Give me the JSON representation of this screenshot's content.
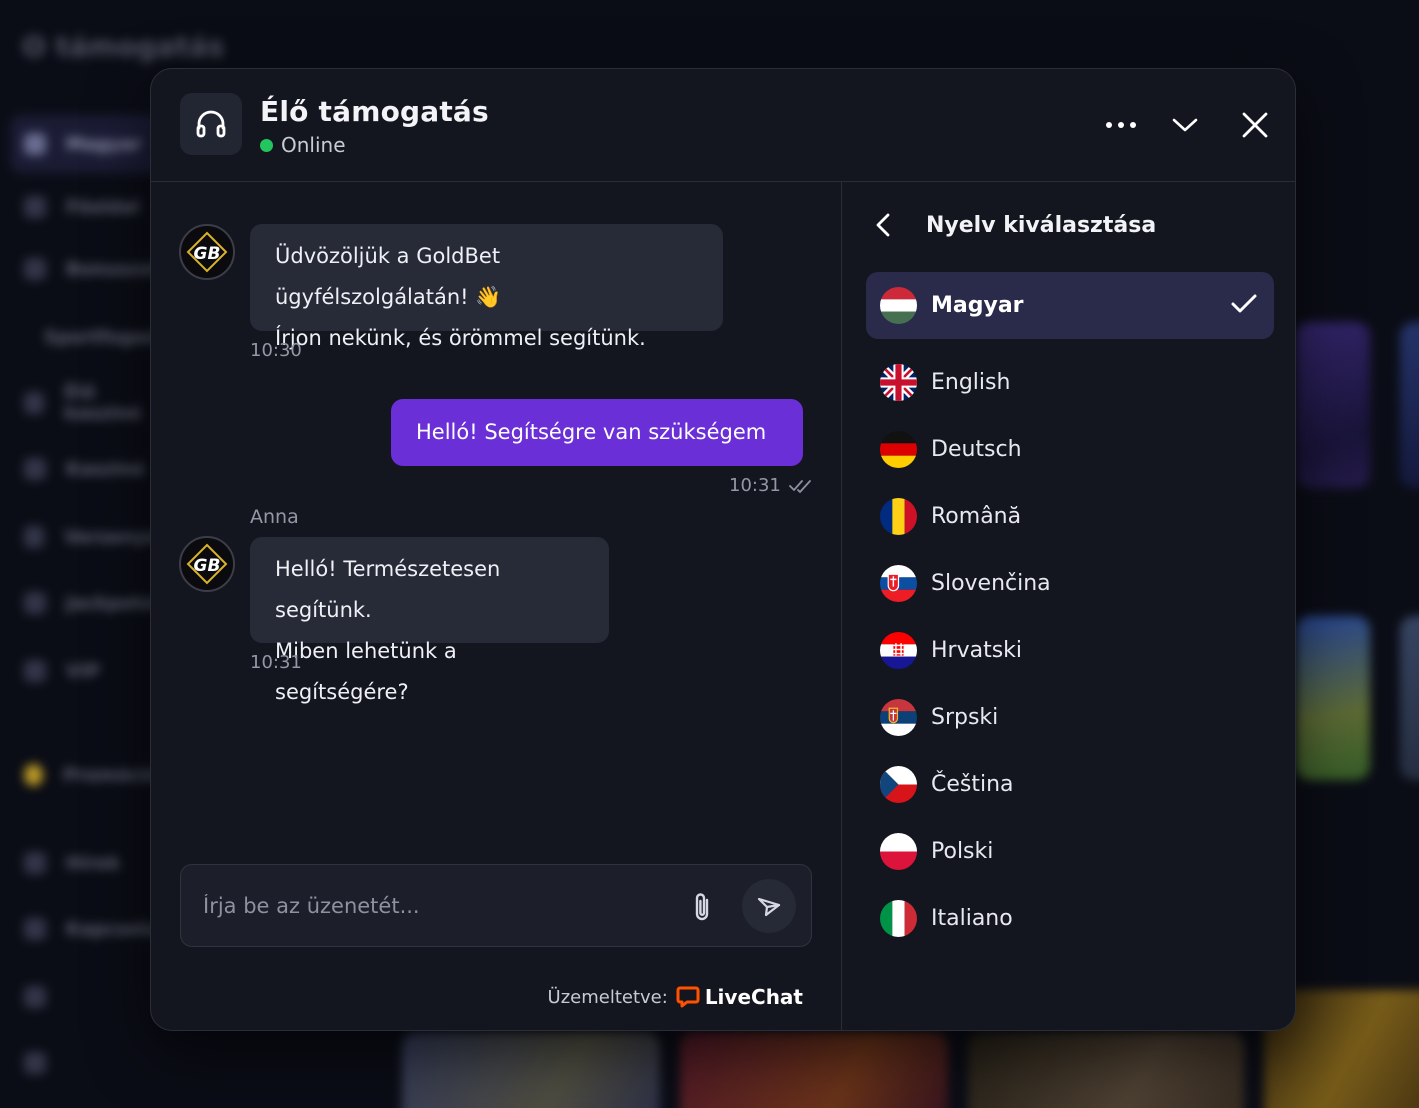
{
  "background": {
    "app_name": "támogatás",
    "sidebar_items": [
      "Magyar",
      "Főoldal",
      "Bonuszok",
      "Sportfogadás",
      "Élő kaszinó",
      "Kaszinó",
      "Versenyek",
      "Jackpotok",
      "VIP",
      "Promóciók",
      "Hírek",
      "Kapcsolat"
    ],
    "sidebar_active": "Magyar"
  },
  "header": {
    "title": "Élő támogatás",
    "status": "Online",
    "status_color": "#22c55e"
  },
  "messages": [
    {
      "direction": "in",
      "sender": "",
      "lines": [
        "Üdvözöljük a GoldBet ügyfélszolgálatán! 👋",
        "Írjon nekünk, és örömmel segítünk."
      ],
      "time": "10:30"
    },
    {
      "direction": "out",
      "lines": [
        "Helló! Segítségre van szükségem"
      ],
      "time": "10:31",
      "read": true
    },
    {
      "direction": "in",
      "sender": "Anna",
      "lines": [
        "Helló! Természetesen segítünk.",
        "Miben lehetünk a segítségére?"
      ],
      "time": "10:31"
    }
  ],
  "composer": {
    "placeholder": "Írja be az üzenetét...",
    "value": ""
  },
  "footer": {
    "powered_by": "Üzemeltetve:",
    "brand": "LiveChat"
  },
  "language_panel": {
    "title": "Nyelv kiválasztása",
    "selected": "Magyar",
    "languages": [
      "Magyar",
      "English",
      "Deutsch",
      "Română",
      "Slovenčina",
      "Hrvatski",
      "Srpski",
      "Čeština",
      "Polski",
      "Italiano"
    ]
  },
  "colors": {
    "accent": "#6a2fd6",
    "selected_row": "#2a2a4a",
    "panel_bg": "#14161f"
  }
}
